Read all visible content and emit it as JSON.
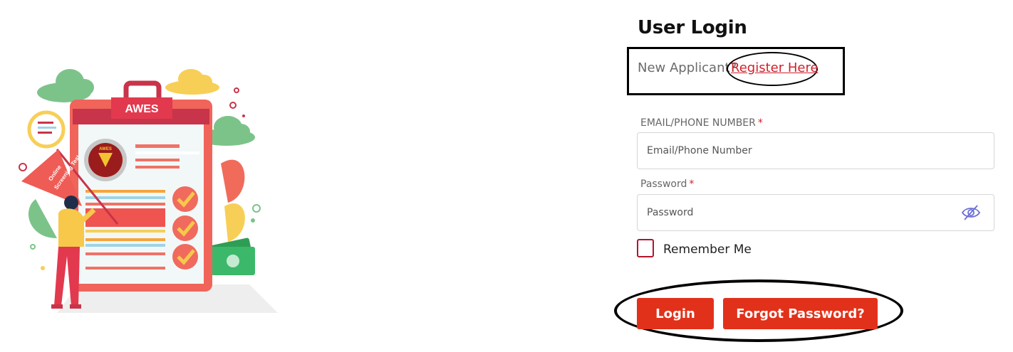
{
  "illustration": {
    "board_title": "AWES",
    "flag_text_line1": "Online",
    "flag_text_line2": "Screening Test",
    "emblem_text": "AWES"
  },
  "login": {
    "title": "User Login",
    "new_applicant_text": "New Applicant?",
    "register_link": "Register Here",
    "email_label": "EMAIL/PHONE NUMBER",
    "email_placeholder": "Email/Phone Number",
    "password_label": "Password",
    "password_placeholder": "Password",
    "required_mark": "*",
    "remember_label": "Remember Me",
    "login_button": "Login",
    "forgot_button": "Forgot Password?"
  },
  "colors": {
    "accent": "#e2311a",
    "link": "#d0202b",
    "checkbox_border": "#b0162a"
  },
  "icons": {
    "password_toggle": "eye-slash-icon"
  }
}
